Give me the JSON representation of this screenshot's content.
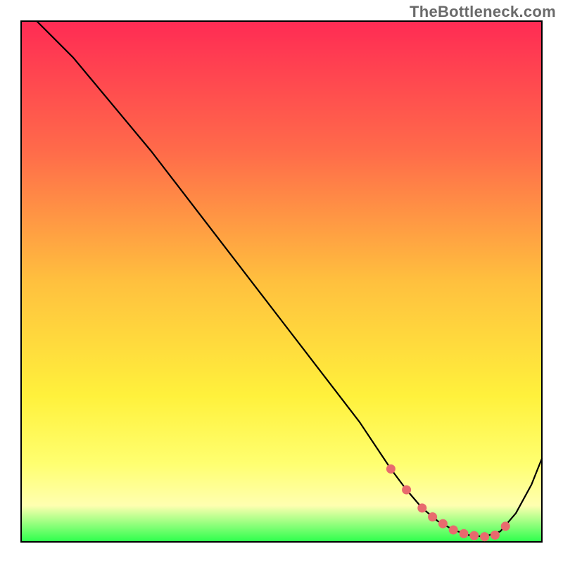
{
  "watermark": "TheBottleneck.com",
  "chart_data": {
    "type": "line",
    "title": "",
    "xlabel": "",
    "ylabel": "",
    "xlim": [
      0,
      100
    ],
    "ylim": [
      0,
      100
    ],
    "grid": false,
    "legend": false,
    "background_gradient": {
      "stops": [
        {
          "offset": 0.0,
          "color": "#ff2b54"
        },
        {
          "offset": 0.25,
          "color": "#ff6b4a"
        },
        {
          "offset": 0.5,
          "color": "#ffc03e"
        },
        {
          "offset": 0.72,
          "color": "#fff13c"
        },
        {
          "offset": 0.85,
          "color": "#ffff70"
        },
        {
          "offset": 0.93,
          "color": "#ffffb0"
        },
        {
          "offset": 1.0,
          "color": "#2bff4c"
        }
      ]
    },
    "series": [
      {
        "name": "bottleneck-curve",
        "color": "#000000",
        "x": [
          3,
          6,
          10,
          15,
          20,
          25,
          30,
          35,
          40,
          45,
          50,
          55,
          60,
          65,
          68,
          71,
          74,
          77,
          80,
          83,
          86,
          89,
          92,
          95,
          98,
          100
        ],
        "y": [
          100,
          97,
          93,
          87,
          81,
          75,
          68.5,
          62,
          55.5,
          49,
          42.5,
          36,
          29.5,
          23,
          18.5,
          14,
          10,
          6.5,
          4,
          2.3,
          1.3,
          1,
          2,
          5.5,
          11,
          16
        ]
      },
      {
        "name": "sweet-spot-markers",
        "color": "#e86a6e",
        "type": "scatter",
        "x": [
          71,
          74,
          77,
          79,
          81,
          83,
          85,
          87,
          89,
          91,
          93
        ],
        "y": [
          14,
          10,
          6.5,
          4.8,
          3.5,
          2.3,
          1.6,
          1.2,
          1.0,
          1.3,
          3.0
        ]
      }
    ]
  }
}
